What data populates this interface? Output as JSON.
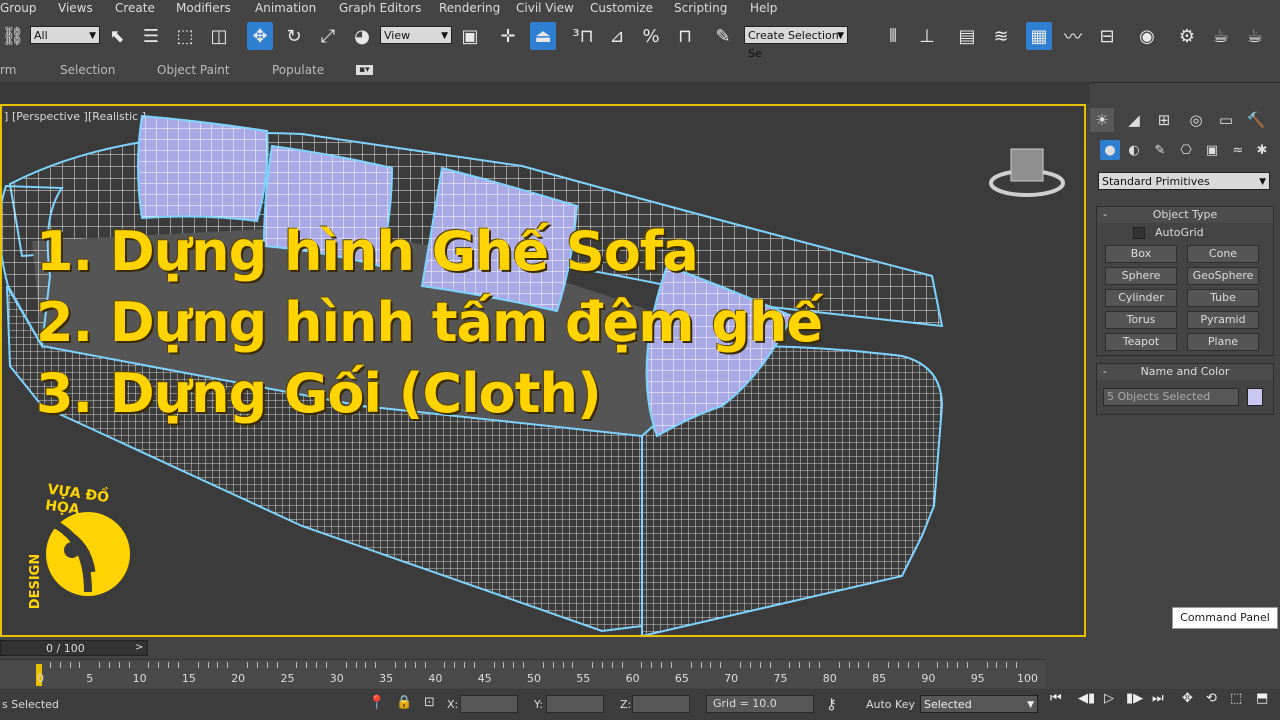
{
  "menu": [
    "Group",
    "Views",
    "Create",
    "Modifiers",
    "Animation",
    "Graph Editors",
    "Rendering",
    "Civil View",
    "Customize",
    "Scripting",
    "Help"
  ],
  "toolbar": {
    "filter_value": "All",
    "refcoord_value": "View",
    "selection_set_placeholder": "Create Selection Se"
  },
  "ribbon": [
    "rm",
    "Selection",
    "Object Paint",
    "Populate"
  ],
  "viewport": {
    "label_left": "]",
    "label_perspective": "[Perspective ]",
    "label_shading": "[Realistic ]"
  },
  "headlines": [
    "1. Dựng hình Ghế Sofa",
    "2. Dựng hình tấm đệm ghế",
    "3. Dựng Gối (Cloth)"
  ],
  "logo": {
    "top_text": "VỰA ĐỒ HỌA",
    "side_text": "DESIGN"
  },
  "command_panel": {
    "category": "Standard Primitives",
    "object_type_title": "Object Type",
    "autogrid_label": "AutoGrid",
    "buttons": [
      "Box",
      "Cone",
      "Sphere",
      "GeoSphere",
      "Cylinder",
      "Tube",
      "Torus",
      "Pyramid",
      "Teapot",
      "Plane"
    ],
    "name_color_title": "Name and Color",
    "name_value": "5 Objects Selected",
    "tooltip": "Command Panel",
    "swatch_color": "#c8c8f2"
  },
  "timeline": {
    "slider_label": "0 / 100",
    "slider_arrow": ">",
    "tick_labels": [
      "0",
      "5",
      "10",
      "15",
      "20",
      "25",
      "30",
      "35",
      "40",
      "45",
      "50",
      "55",
      "60",
      "65",
      "70",
      "75",
      "80",
      "85",
      "90",
      "95",
      "100"
    ]
  },
  "status": {
    "selected_text": "s Selected",
    "x_label": "X:",
    "y_label": "Y:",
    "z_label": "Z:",
    "grid_text": "Grid = 10.0",
    "autokey_label": "Auto Key",
    "autokey_value": "Selected"
  },
  "colors": {
    "accent_yellow": "#ffd400",
    "viewport_border": "#e7c000",
    "wire_highlight": "#7fd4ff",
    "cushion": "#a9a9e6"
  }
}
